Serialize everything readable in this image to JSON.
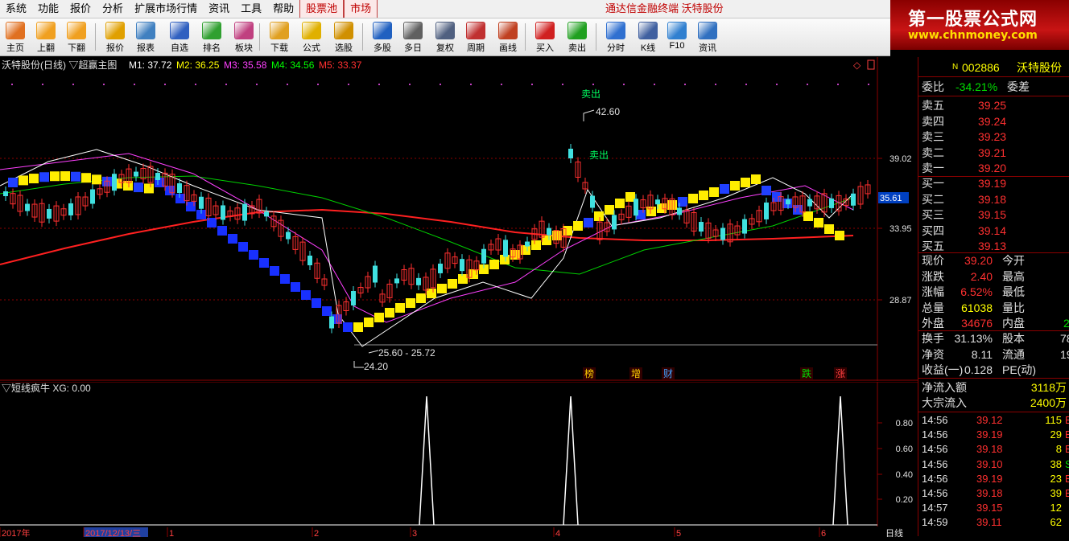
{
  "menu": {
    "items": [
      "系统",
      "功能",
      "报价",
      "分析",
      "扩展市场行情",
      "资讯",
      "工具",
      "帮助"
    ],
    "tabs": [
      "股票池",
      "市场"
    ],
    "window_title": "通达信金融终端  沃特股份"
  },
  "logo": {
    "line1": "第一股票公式网",
    "line2": "www.chnmoney.com"
  },
  "toolbar": [
    {
      "label": "主页",
      "icon": "home-icon",
      "color": "#e07020"
    },
    {
      "label": "上翻",
      "icon": "arrow-up-icon",
      "color": "#f0a020"
    },
    {
      "label": "下翻",
      "icon": "arrow-down-icon",
      "color": "#f0a020"
    },
    {
      "label": "报价",
      "icon": "yen-icon",
      "color": "#e0a000"
    },
    {
      "label": "报表",
      "icon": "report-icon",
      "color": "#4080c0"
    },
    {
      "label": "自选",
      "icon": "f6-icon",
      "color": "#3060c0"
    },
    {
      "label": "排名",
      "icon": "rank-icon",
      "color": "#30a030"
    },
    {
      "label": "板块",
      "icon": "blocks-icon",
      "color": "#c04080"
    },
    {
      "label": "下载",
      "icon": "download-icon",
      "color": "#e0a020"
    },
    {
      "label": "公式",
      "icon": "formula-icon",
      "color": "#e0b000"
    },
    {
      "label": "选股",
      "icon": "pick-icon",
      "color": "#d09000"
    },
    {
      "label": "多股",
      "icon": "multi-chart-icon",
      "color": "#2060c0"
    },
    {
      "label": "多日",
      "icon": "clock-icon",
      "color": "#606060"
    },
    {
      "label": "复权",
      "icon": "restore-icon",
      "color": "#506080"
    },
    {
      "label": "周期",
      "icon": "f8-icon",
      "color": "#c03030"
    },
    {
      "label": "画线",
      "icon": "pen-icon",
      "color": "#c04020"
    },
    {
      "label": "买入",
      "icon": "buy-icon",
      "color": "#d02020"
    },
    {
      "label": "卖出",
      "icon": "sell-icon",
      "color": "#20a020"
    },
    {
      "label": "分时",
      "icon": "intraday-icon",
      "color": "#3070d0"
    },
    {
      "label": "K线",
      "icon": "candlestick-icon",
      "color": "#4060a0"
    },
    {
      "label": "F10",
      "icon": "f10-icon",
      "color": "#3080d0"
    },
    {
      "label": "资讯",
      "icon": "news-icon",
      "color": "#3070c0"
    }
  ],
  "main_chart": {
    "title": "沃特股份(日线) ▽超赢主图",
    "ma": [
      {
        "label": "M1: 37.72",
        "color": "#ffffff"
      },
      {
        "label": "M2: 36.25",
        "color": "#ffff00"
      },
      {
        "label": "M3: 35.58",
        "color": "#ff40ff"
      },
      {
        "label": "M4: 34.56",
        "color": "#00ff00"
      },
      {
        "label": "M5: 33.37",
        "color": "#ff3030"
      }
    ],
    "price_ticks": [
      "39.02",
      "33.95",
      "28.87"
    ],
    "current_price_tag": "35.61",
    "annotations": {
      "sell1": "卖出",
      "sell2": "卖出",
      "high_label": "42.60",
      "range_label": "25.60 - 25.72",
      "low_label": "24.20"
    },
    "event_markers": [
      {
        "text": "榜",
        "color": "#ffd000"
      },
      {
        "text": "增",
        "color": "#ffd000"
      },
      {
        "text": "财",
        "color": "#40a0ff"
      },
      {
        "text": "跌",
        "color": "#00e000"
      },
      {
        "text": "涨",
        "color": "#ff4040"
      }
    ]
  },
  "sub_chart": {
    "title": "▽短线疯牛 XG: 0.00",
    "ticks": [
      "0.80",
      "0.60",
      "0.40",
      "0.20"
    ]
  },
  "time_axis": {
    "labels": [
      "2017年",
      "2017/12/13/三",
      "1",
      "2",
      "3",
      "4",
      "5",
      "6"
    ],
    "period": "日线"
  },
  "chart_data": {
    "type": "line",
    "title": "▽短线疯牛 XG: 0.00",
    "series": [
      {
        "name": "XG",
        "spikes_at_month_labels": [
          "3",
          "4",
          "6"
        ],
        "values": [
          0,
          1,
          0,
          1,
          0,
          1,
          0
        ]
      }
    ],
    "ylim": [
      0,
      1
    ]
  },
  "right_panel": {
    "code": "002886",
    "name": "沃特股份",
    "weibi": {
      "label": "委比",
      "value": "-34.21%",
      "label2": "委差"
    },
    "sell": [
      {
        "label": "卖五",
        "price": "39.25"
      },
      {
        "label": "卖四",
        "price": "39.24"
      },
      {
        "label": "卖三",
        "price": "39.23"
      },
      {
        "label": "卖二",
        "price": "39.21"
      },
      {
        "label": "卖一",
        "price": "39.20"
      }
    ],
    "buy": [
      {
        "label": "买一",
        "price": "39.19"
      },
      {
        "label": "买二",
        "price": "39.18"
      },
      {
        "label": "买三",
        "price": "39.15"
      },
      {
        "label": "买四",
        "price": "39.14"
      },
      {
        "label": "买五",
        "price": "39.13"
      }
    ],
    "stats": [
      {
        "l": "现价",
        "v": "39.20",
        "l2": "今开",
        "c": "#ff3030"
      },
      {
        "l": "涨跌",
        "v": "2.40",
        "l2": "最高",
        "c": "#ff3030"
      },
      {
        "l": "涨幅",
        "v": "6.52%",
        "l2": "最低",
        "c": "#ff3030"
      },
      {
        "l": "总量",
        "v": "61038",
        "l2": "量比",
        "c": "#ffff00"
      },
      {
        "l": "外盘",
        "v": "34676",
        "l2": "内盘",
        "c": "#ff3030"
      }
    ],
    "stats2": [
      {
        "l": "换手",
        "v": "31.13%",
        "l2": "股本",
        "r": "78"
      },
      {
        "l": "净资",
        "v": "8.11",
        "l2": "流通",
        "r": "19"
      },
      {
        "l": "收益(一)",
        "v": "0.128",
        "l2": "PE(动)",
        "r": ""
      }
    ],
    "inner_green": "2",
    "flows": [
      {
        "l": "净流入额",
        "v": "3118万"
      },
      {
        "l": "大宗流入",
        "v": "2400万"
      }
    ],
    "ticks": [
      {
        "t": "14:56",
        "p": "39.12",
        "v": "115",
        "s": "B",
        "c": "#ff3030"
      },
      {
        "t": "14:56",
        "p": "39.19",
        "v": "29",
        "s": "B",
        "c": "#ff3030"
      },
      {
        "t": "14:56",
        "p": "39.18",
        "v": "8",
        "s": "B",
        "c": "#ff3030"
      },
      {
        "t": "14:56",
        "p": "39.10",
        "v": "38",
        "s": "S",
        "c": "#00e000"
      },
      {
        "t": "14:56",
        "p": "39.19",
        "v": "23",
        "s": "B",
        "c": "#ff3030"
      },
      {
        "t": "14:56",
        "p": "39.18",
        "v": "39",
        "s": "B",
        "c": "#ff3030"
      },
      {
        "t": "14:57",
        "p": "39.15",
        "v": "12",
        "s": "",
        "c": "#ff3030"
      },
      {
        "t": "14:59",
        "p": "39.11",
        "v": "62",
        "s": "",
        "c": "#ff3030"
      }
    ]
  }
}
